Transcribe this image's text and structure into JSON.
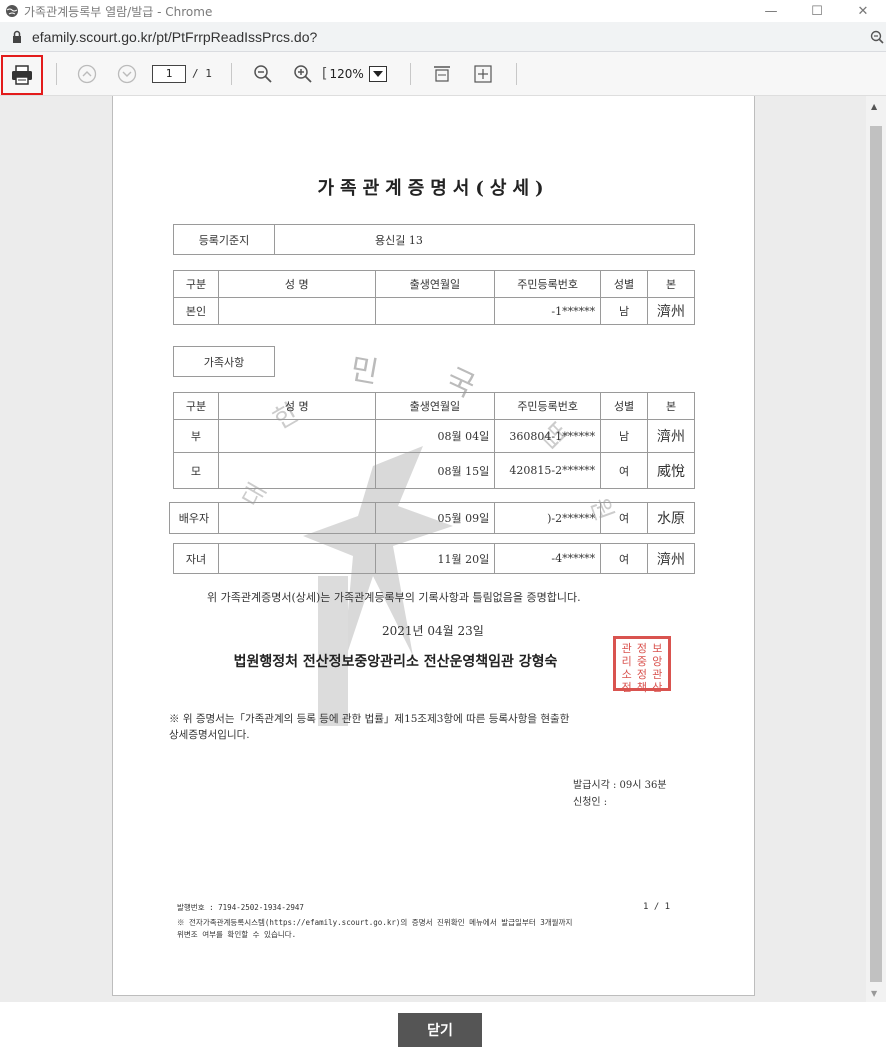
{
  "window": {
    "title": "가족관계등록부 열람/발급 - Chrome",
    "minimize": "—",
    "maximize": "☐",
    "close": "✕"
  },
  "address": {
    "url": "efamily.scourt.go.kr/pt/PtFrrpReadIssPrcs.do?"
  },
  "toolbar": {
    "page_current": "1",
    "page_total": "/ 1",
    "zoom_value": "120%"
  },
  "document": {
    "title": "가족관계증명서(상세)",
    "reg_label": "등록기준지",
    "reg_value": "용신길 13",
    "person_headers": [
      "구분",
      "성  명",
      "출생연월일",
      "주민등록번호",
      "성별",
      "본"
    ],
    "person_row": [
      "본인",
      "",
      "",
      "-1******",
      "남",
      "濟州"
    ],
    "family_label": "가족사항",
    "family_headers": [
      "구분",
      "성  명",
      "출생연월일",
      "주민등록번호",
      "성별",
      "본"
    ],
    "family_rows": [
      [
        "부",
        "",
        "08월 04일",
        "360804-1******",
        "남",
        "濟州"
      ],
      [
        "모",
        "",
        "08월 15일",
        "420815-2******",
        "여",
        "威悅"
      ]
    ],
    "spouse_row": [
      "배우자",
      "",
      "05월 09일",
      ")-2******",
      "여",
      "水原"
    ],
    "child_row": [
      "자녀",
      "",
      "11월 20일",
      "-4******",
      "여",
      "濟州"
    ],
    "certify_text": "위 가족관계증명서(상세)는 가족관계등록부의 기록사항과 틀림없음을 증명합니다.",
    "date": "2021년 04월 23일",
    "issuer": "법원행정처 전산정보중앙관리소 전산운영책임관 강형숙",
    "seal_chars": [
      "관",
      "정",
      "보",
      "리",
      "중",
      "앙",
      "소",
      "정",
      "관",
      "전",
      "책",
      "산",
      "운",
      "임",
      "영"
    ],
    "note_line1": "※ 위 증명서는「가족관계의 등록 등에 관한 법률」제15조제3항에 따른 등록사항을 현출한",
    "note_line2": "상세증명서입니다.",
    "issue_time": "발급시각 : 09시 36분",
    "applicant": "신청인 :",
    "issue_no": "발행번호 : 7194-2502-1934-2947",
    "page_of": "1 / 1",
    "footer_line1": "※ 전자가족관계등록시스템(https://efamily.scourt.go.kr)의 증명서 진위확인 메뉴에서 발급일부터 3개월까지",
    "footer_line2": "위변조 여부를 확인할 수 있습니다."
  },
  "watermark_chars": [
    "대",
    "한",
    "민",
    "국",
    "법",
    "원"
  ],
  "bottom": {
    "close_label": "닫기"
  },
  "colors": {
    "highlight": "#e31b1b",
    "seal": "#d9534f",
    "button": "#555555"
  }
}
